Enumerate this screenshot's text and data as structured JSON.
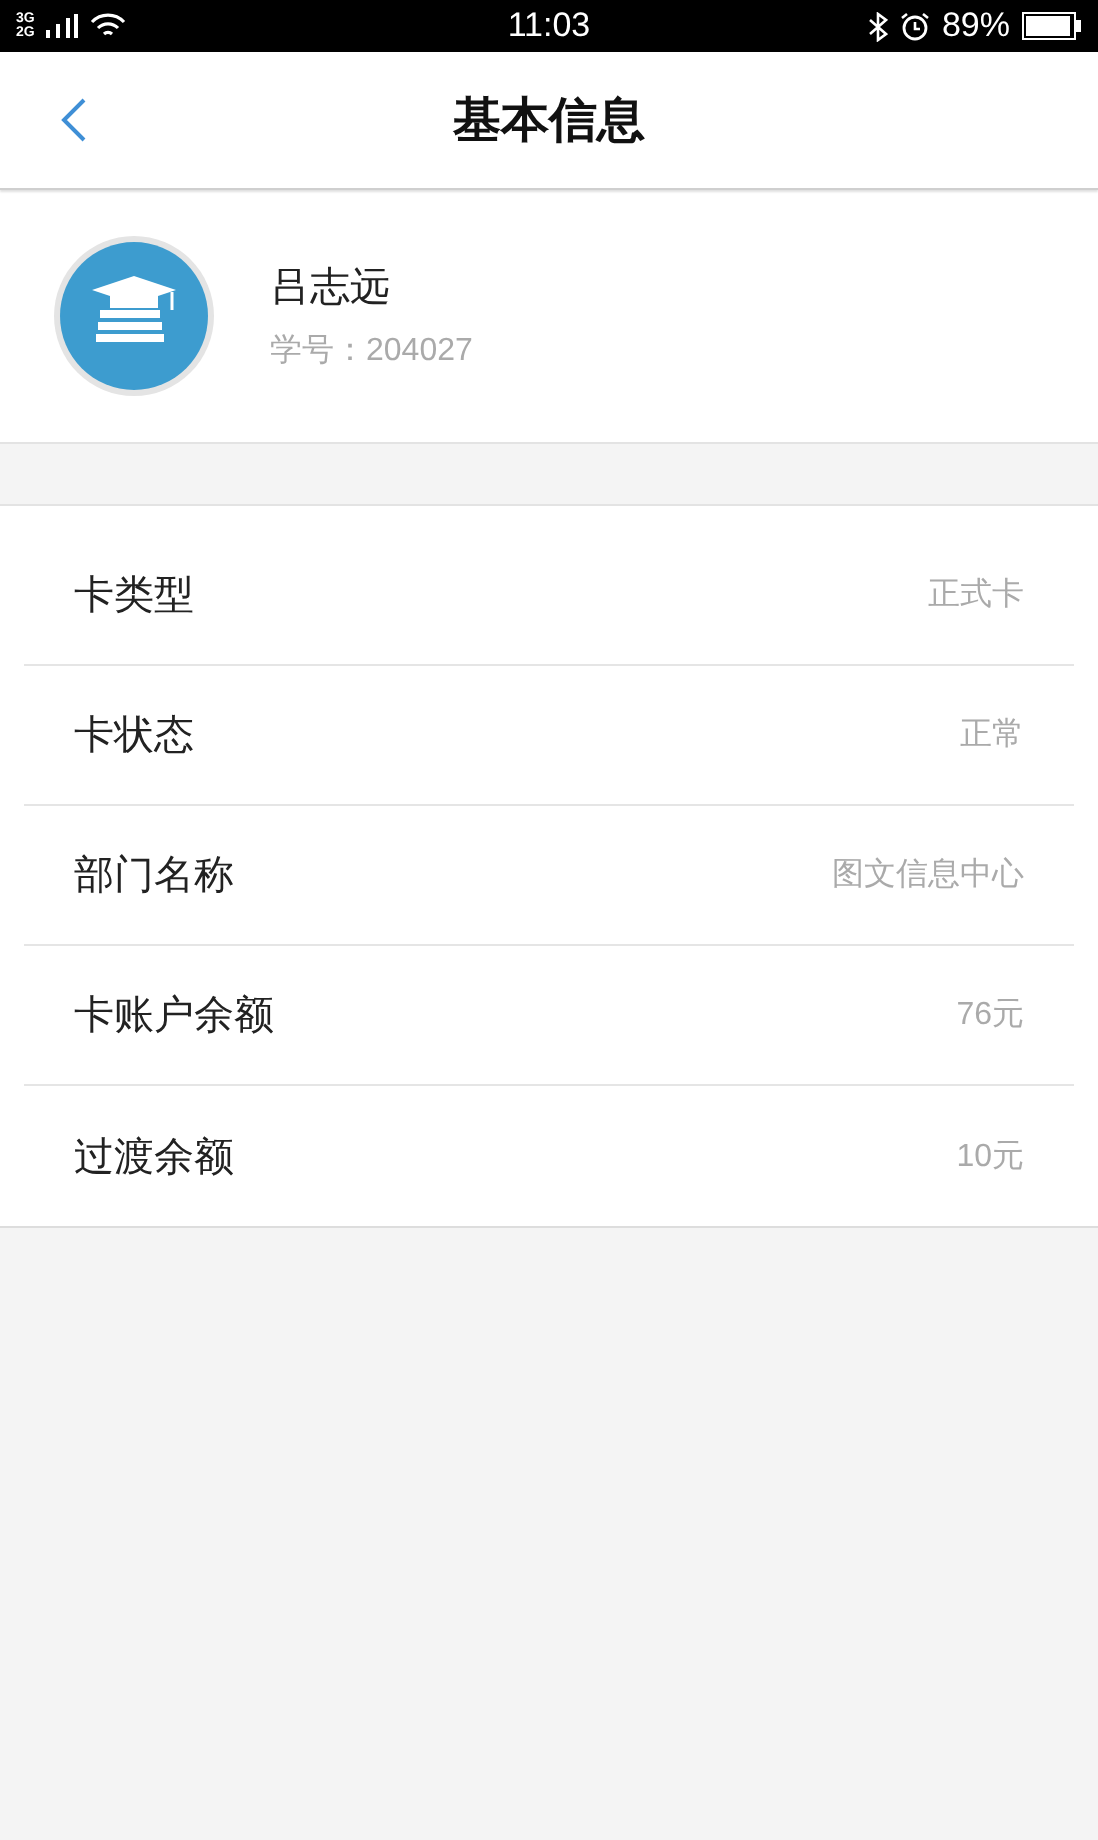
{
  "status_bar": {
    "network_top": "3G",
    "network_bottom": "2G",
    "time": "11:03",
    "battery": "89%"
  },
  "header": {
    "title": "基本信息"
  },
  "profile": {
    "name": "吕志远",
    "id_label": "学号：204027"
  },
  "rows": [
    {
      "label": "卡类型",
      "value": "正式卡"
    },
    {
      "label": "卡状态",
      "value": "正常"
    },
    {
      "label": "部门名称",
      "value": "图文信息中心"
    },
    {
      "label": "卡账户余额",
      "value": "76元"
    },
    {
      "label": "过渡余额",
      "value": "10元"
    }
  ]
}
